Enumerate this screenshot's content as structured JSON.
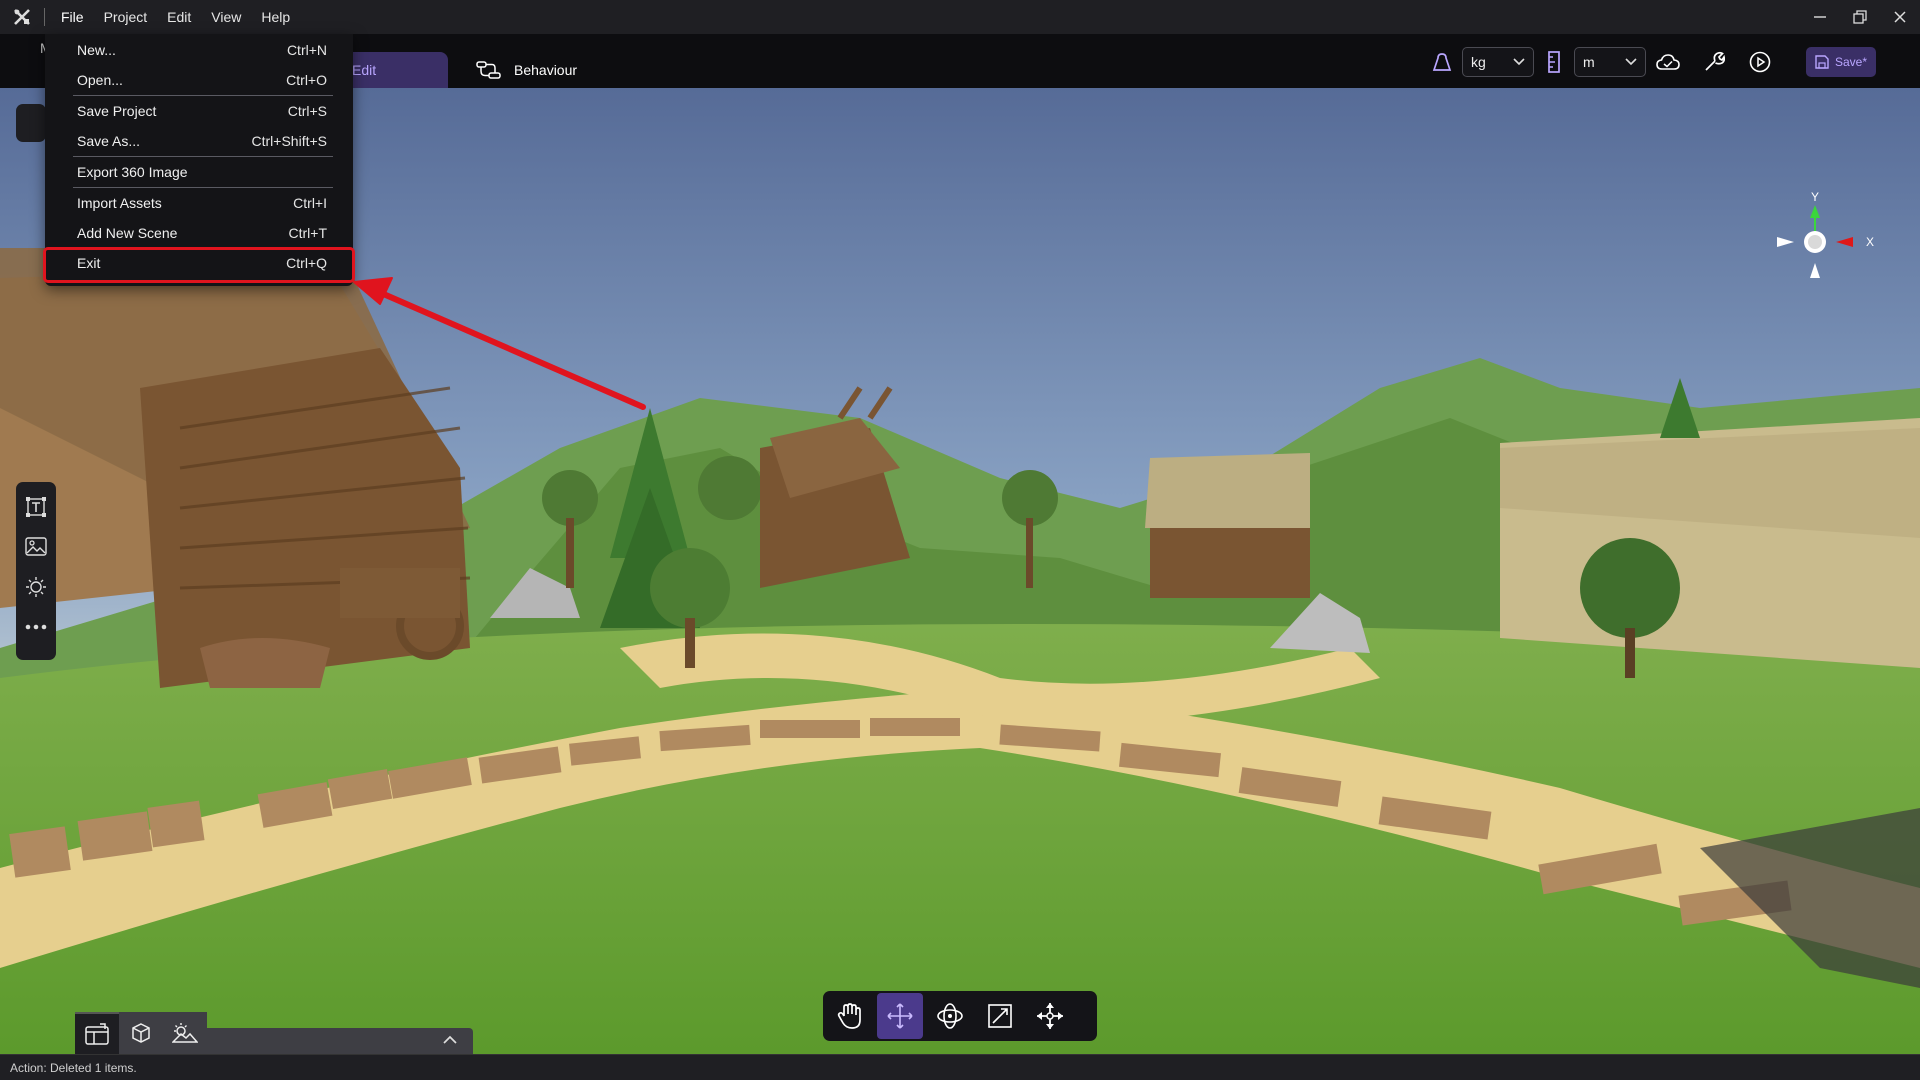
{
  "titlebar": {
    "menus": [
      "File",
      "Project",
      "Edit",
      "View",
      "Help"
    ],
    "logo_icon": "cross-tools-icon"
  },
  "toolbar": {
    "tab_edit": "Edit",
    "tab_behaviour": "Behaviour",
    "hidden_mode_label": "M",
    "weight_unit": "kg",
    "length_unit": "m",
    "save_label": "Save*"
  },
  "file_menu": {
    "groups": [
      [
        {
          "label": "New...",
          "shortcut": "Ctrl+N"
        },
        {
          "label": "Open...",
          "shortcut": "Ctrl+O"
        }
      ],
      [
        {
          "label": "Save Project",
          "shortcut": "Ctrl+S"
        },
        {
          "label": "Save As...",
          "shortcut": "Ctrl+Shift+S"
        }
      ],
      [
        {
          "label": "Export 360 Image",
          "shortcut": ""
        }
      ],
      [
        {
          "label": "Import Assets",
          "shortcut": "Ctrl+I"
        },
        {
          "label": "Add New Scene",
          "shortcut": "Ctrl+T"
        },
        {
          "label": "Exit",
          "shortcut": "Ctrl+Q"
        }
      ]
    ],
    "highlighted_item": "Exit"
  },
  "gizmo": {
    "y_label": "Y",
    "x_label": "X"
  },
  "transform_tools": [
    "hand-icon",
    "move-icon",
    "rotate-icon",
    "scale-icon",
    "pivot-icon"
  ],
  "active_transform_tool": "move-icon",
  "left_tools": [
    "text-frame-icon",
    "image-icon",
    "light-icon",
    "more-icon"
  ],
  "bottom_tabs": [
    "scene-icon",
    "object-icon",
    "environment-icon"
  ],
  "statusbar": {
    "text": "Action: Deleted 1 items."
  },
  "colors": {
    "accent": "#3a2f66",
    "accent_text": "#b9a6ff",
    "annotation_red": "#e0141e"
  }
}
